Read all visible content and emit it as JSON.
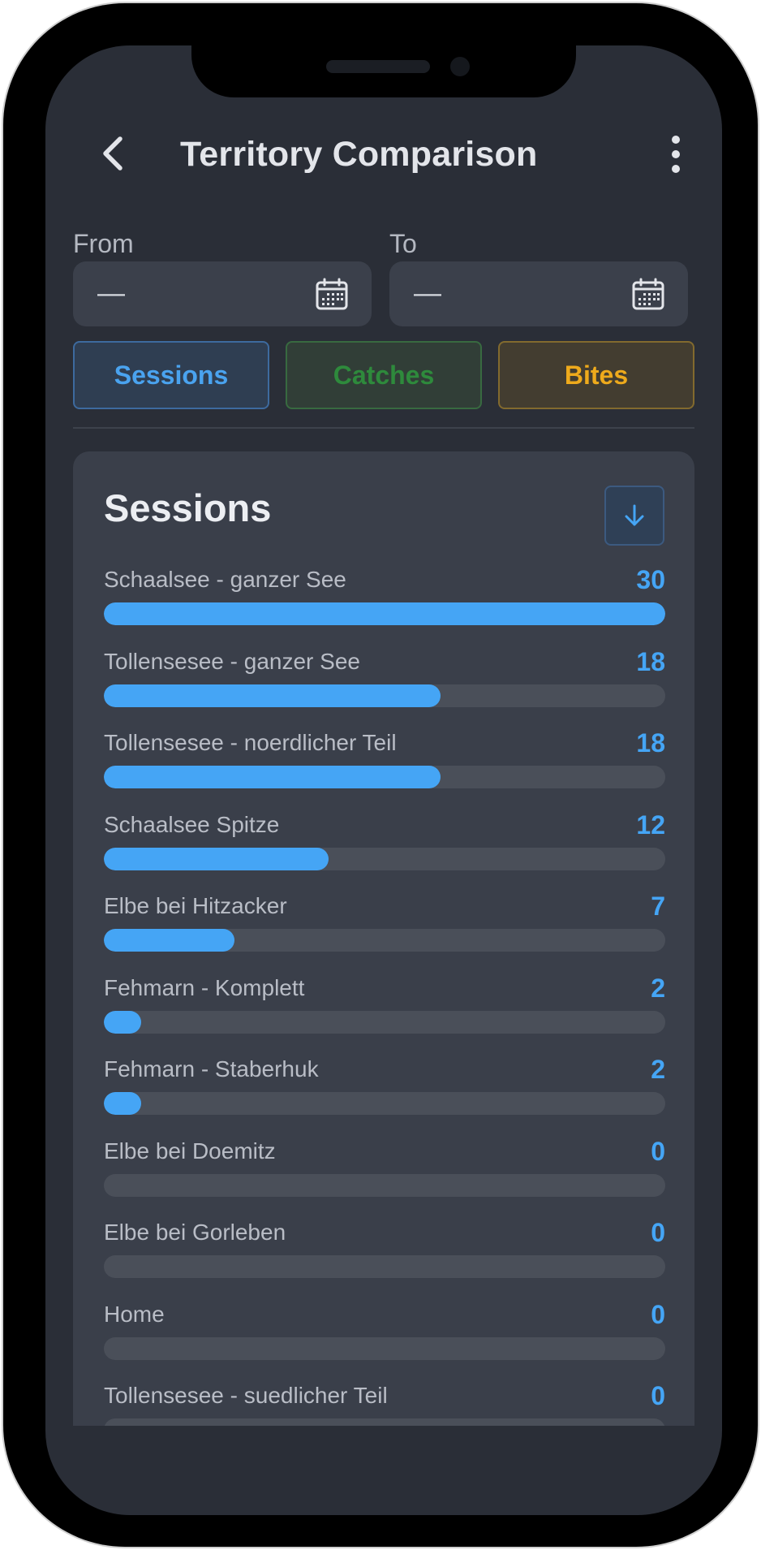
{
  "header": {
    "title": "Territory Comparison",
    "back_icon": "chevron-left-icon",
    "more_icon": "more-vertical-icon"
  },
  "date_range": {
    "from_label": "From",
    "from_value": "—",
    "to_label": "To",
    "to_value": "—",
    "icon": "calendar-icon"
  },
  "tabs": [
    {
      "label": "Sessions",
      "color": "#4aa3ef",
      "bg": "#2f3e52",
      "border": "#3d6a9e",
      "selected": true
    },
    {
      "label": "Catches",
      "color": "#2e8a3c",
      "bg": "#313e37",
      "border": "#386a40",
      "selected": false
    },
    {
      "label": "Bites",
      "color": "#eeaa1c",
      "bg": "#433d30",
      "border": "#826a2e",
      "selected": false
    }
  ],
  "card": {
    "title": "Sessions",
    "sort_icon": "arrow-down-icon",
    "max_value": 30,
    "rows": [
      {
        "label": "Schaalsee - ganzer See",
        "value": 30
      },
      {
        "label": "Tollensesee - ganzer See",
        "value": 18
      },
      {
        "label": "Tollensesee - noerdlicher Teil",
        "value": 18
      },
      {
        "label": "Schaalsee Spitze",
        "value": 12
      },
      {
        "label": "Elbe bei Hitzacker",
        "value": 7
      },
      {
        "label": "Fehmarn - Komplett",
        "value": 2
      },
      {
        "label": "Fehmarn - Staberhuk",
        "value": 2
      },
      {
        "label": "Elbe bei Doemitz",
        "value": 0
      },
      {
        "label": "Elbe bei Gorleben",
        "value": 0
      },
      {
        "label": "Home",
        "value": 0
      },
      {
        "label": "Tollensesee - suedlicher Teil",
        "value": 0
      }
    ]
  },
  "colors": {
    "accent": "#45a5f5",
    "screen_bg": "#2a2e37",
    "card_bg": "#3a3f4a"
  }
}
